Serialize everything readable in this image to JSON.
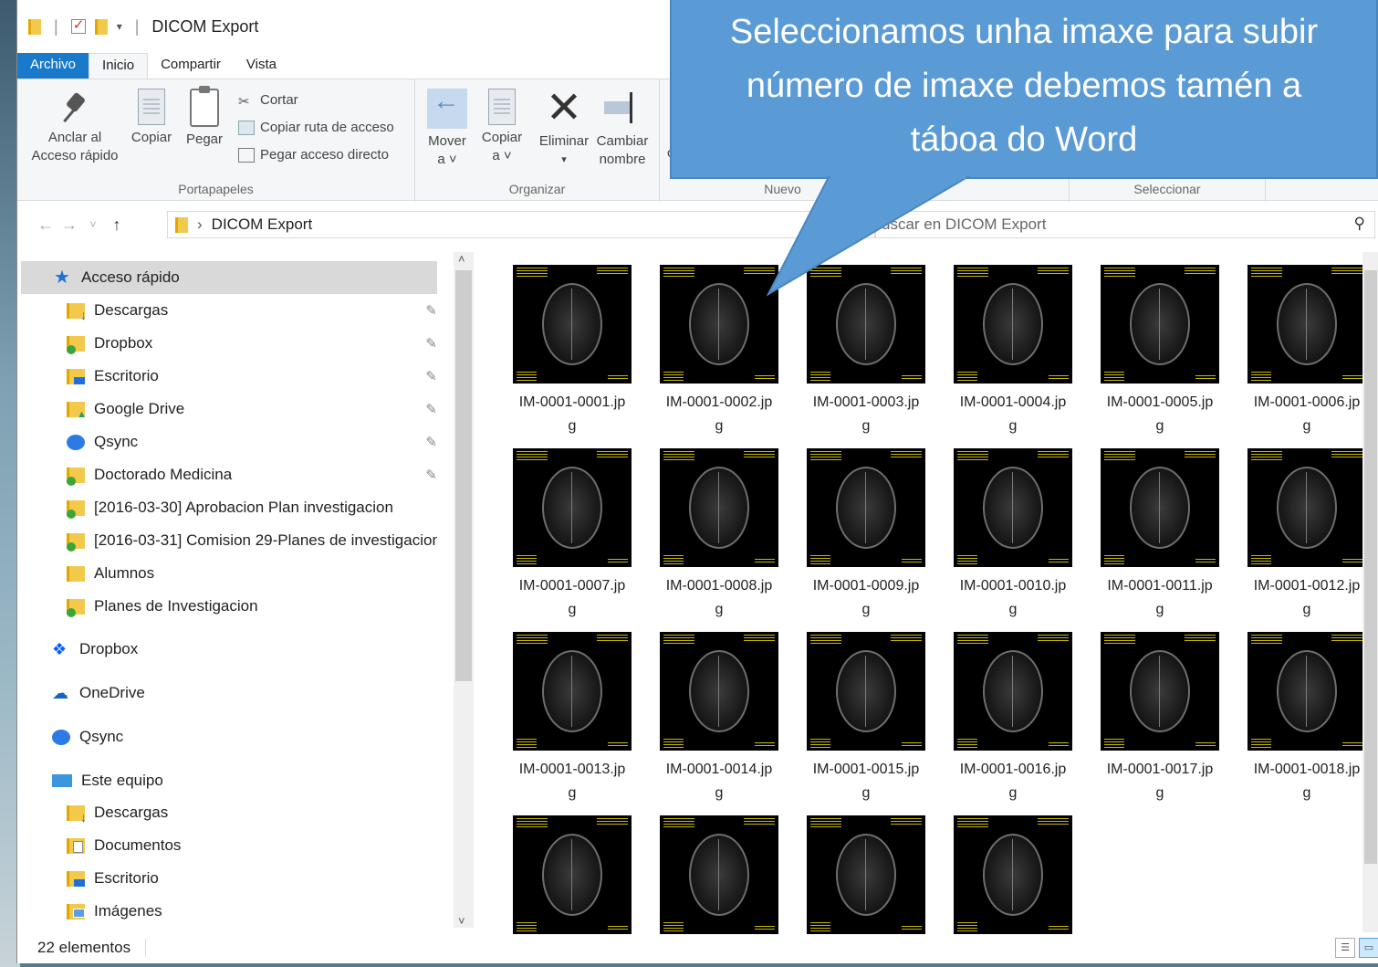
{
  "window": {
    "title": "DICOM Export"
  },
  "ribbon_tabs": [
    "Archivo",
    "Inicio",
    "Compartir",
    "Vista"
  ],
  "ribbon": {
    "portapapeles": {
      "label": "Portapapeles",
      "pin_line1": "Anclar al",
      "pin_line2": "Acceso rápido",
      "copy": "Copiar",
      "paste": "Pegar",
      "cut": "Cortar",
      "copy_path": "Copiar ruta de acceso",
      "paste_shortcut": "Pegar acceso directo"
    },
    "organizar": {
      "label": "Organizar",
      "move_line1": "Mover",
      "move_line2": "a ˅",
      "copy_line1": "Copiar",
      "copy_line2": "a ˅",
      "delete": "Eliminar",
      "delete_arrow": "▾",
      "rename_line1": "Cambiar",
      "rename_line2": "nombre",
      "partial": "ca"
    },
    "nuevo": {
      "label": "Nuevo"
    },
    "seleccionar": {
      "label": "Seleccionar"
    }
  },
  "callout": {
    "line1": "Seleccionamos unha imaxe para subir",
    "line2": "número de imaxe debemos tamén a",
    "line3": "táboa do Word"
  },
  "address": {
    "breadcrumb": "DICOM Export",
    "search_placeholder": "uscar en DICOM Export"
  },
  "nav": {
    "quick_access": "Acceso rápido",
    "items": [
      {
        "label": "Descargas",
        "pinned": true
      },
      {
        "label": "Dropbox",
        "pinned": true
      },
      {
        "label": "Escritorio",
        "pinned": true
      },
      {
        "label": "Google Drive",
        "pinned": true
      },
      {
        "label": "Qsync",
        "pinned": true
      },
      {
        "label": "Doctorado Medicina",
        "pinned": true
      },
      {
        "label": "[2016-03-30] Aprobacion Plan investigacion",
        "pinned": false
      },
      {
        "label": "[2016-03-31] Comision 29-Planes de investigacion",
        "pinned": false
      },
      {
        "label": "Alumnos",
        "pinned": false
      },
      {
        "label": "Planes de Investigacion",
        "pinned": false
      }
    ],
    "dropbox": "Dropbox",
    "onedrive": "OneDrive",
    "qsync": "Qsync",
    "this_pc": "Este equipo",
    "pc_items": [
      "Descargas",
      "Documentos",
      "Escritorio",
      "Imágenes"
    ]
  },
  "files": [
    {
      "line1": "IM-0001-0001.jp",
      "line2": "g"
    },
    {
      "line1": "IM-0001-0002.jp",
      "line2": "g"
    },
    {
      "line1": "IM-0001-0003.jp",
      "line2": "g"
    },
    {
      "line1": "IM-0001-0004.jp",
      "line2": "g"
    },
    {
      "line1": "IM-0001-0005.jp",
      "line2": "g"
    },
    {
      "line1": "IM-0001-0006.jp",
      "line2": "g"
    },
    {
      "line1": "IM-0001-0007.jp",
      "line2": "g"
    },
    {
      "line1": "IM-0001-0008.jp",
      "line2": "g"
    },
    {
      "line1": "IM-0001-0009.jp",
      "line2": "g"
    },
    {
      "line1": "IM-0001-0010.jp",
      "line2": "g"
    },
    {
      "line1": "IM-0001-0011.jp",
      "line2": "g"
    },
    {
      "line1": "IM-0001-0012.jp",
      "line2": "g"
    },
    {
      "line1": "IM-0001-0013.jp",
      "line2": "g"
    },
    {
      "line1": "IM-0001-0014.jp",
      "line2": "g"
    },
    {
      "line1": "IM-0001-0015.jp",
      "line2": "g"
    },
    {
      "line1": "IM-0001-0016.jp",
      "line2": "g"
    },
    {
      "line1": "IM-0001-0017.jp",
      "line2": "g"
    },
    {
      "line1": "IM-0001-0018.jp",
      "line2": "g"
    },
    {
      "line1": "",
      "line2": ""
    },
    {
      "line1": "",
      "line2": ""
    },
    {
      "line1": "",
      "line2": ""
    },
    {
      "line1": "",
      "line2": ""
    }
  ],
  "status": {
    "count": "22 elementos"
  },
  "colors": {
    "accent": "#1979ca",
    "callout": "#5b9bd5",
    "selection": "#d9d9d9"
  }
}
